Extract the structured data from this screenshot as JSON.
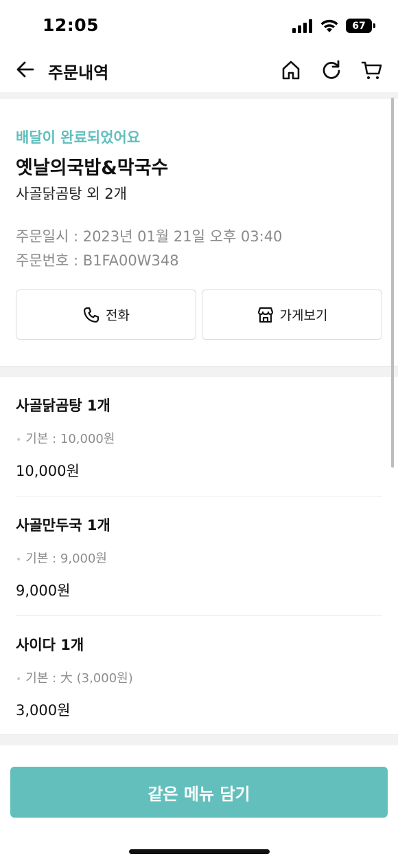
{
  "status_bar": {
    "time": "12:05",
    "battery": "67"
  },
  "header": {
    "title": "주문내역"
  },
  "summary": {
    "delivery_status": "배달이 완료되었어요",
    "store_name": "옛날의국밥&막국수",
    "items_summary": "사골닭곰탕 외 2개",
    "order_date": "주문일시 : 2023년 01월 21일 오후 03:40",
    "order_number": "주문번호 : B1FA00W348",
    "call_label": "전화",
    "store_label": "가게보기"
  },
  "items": [
    {
      "name": "사골닭곰탕 1개",
      "option": "기본 : 10,000원",
      "price": "10,000원"
    },
    {
      "name": "사골만두국 1개",
      "option": "기본 : 9,000원",
      "price": "9,000원"
    },
    {
      "name": "사이다 1개",
      "option": "기본 : 大 (3,000원)",
      "price": "3,000원"
    }
  ],
  "footer": {
    "reorder_label": "같은 메뉴 담기"
  },
  "colors": {
    "accent": "#5fbfbd",
    "button": "#62bfbc",
    "muted": "#8a8a8a"
  }
}
